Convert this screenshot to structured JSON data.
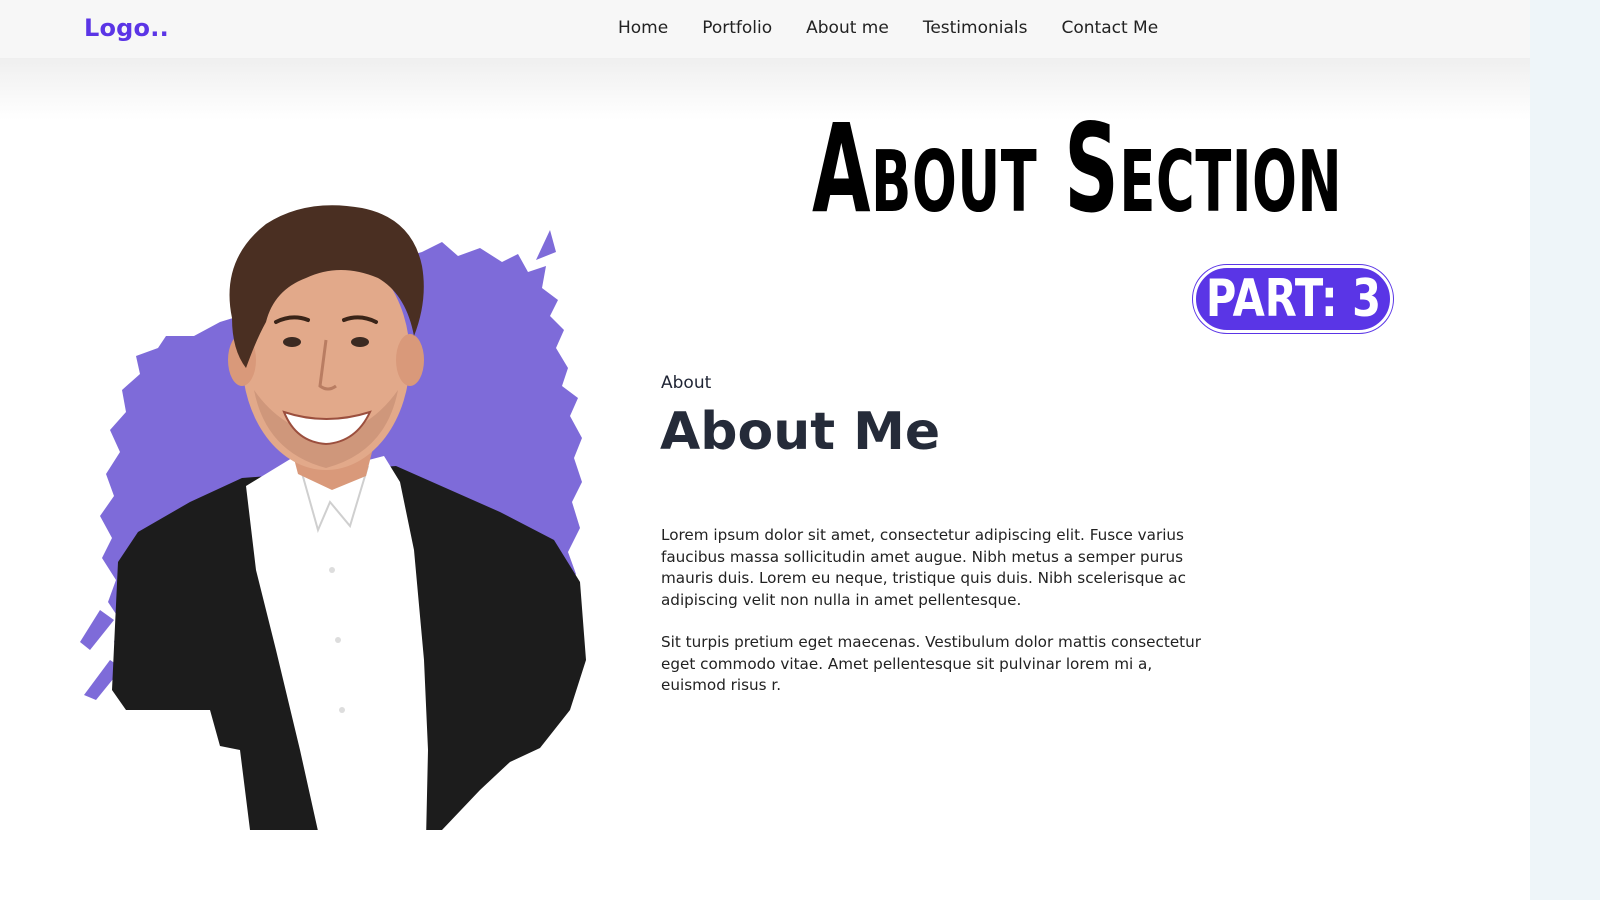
{
  "header": {
    "logo": "Logo..",
    "nav": [
      "Home",
      "Portfolio",
      "About me",
      "Testimonials",
      "Contact Me"
    ]
  },
  "promo": {
    "title": "About Section",
    "badge": "PART: 3"
  },
  "about": {
    "eyebrow": "About",
    "heading": "About Me",
    "paragraphs": [
      "Lorem ipsum dolor sit amet, consectetur adipiscing elit. Fusce varius faucibus massa sollicitudin amet augue. Nibh metus a semper purus mauris duis. Lorem eu neque, tristique quis duis. Nibh scelerisque ac adipiscing velit non nulla in amet pellentesque.",
      "Sit turpis pretium eget maecenas. Vestibulum dolor mattis consectetur eget commodo vitae. Amet pellentesque sit pulvinar lorem mi a, euismod risus r."
    ]
  },
  "colors": {
    "accent": "#5b35e6",
    "splash": "#7e6bd9",
    "text_dark": "#252b39",
    "jacket": "#1c1c1c",
    "shirt": "#ffffff",
    "skin": "#e2a98a",
    "hair": "#4a2f22"
  }
}
